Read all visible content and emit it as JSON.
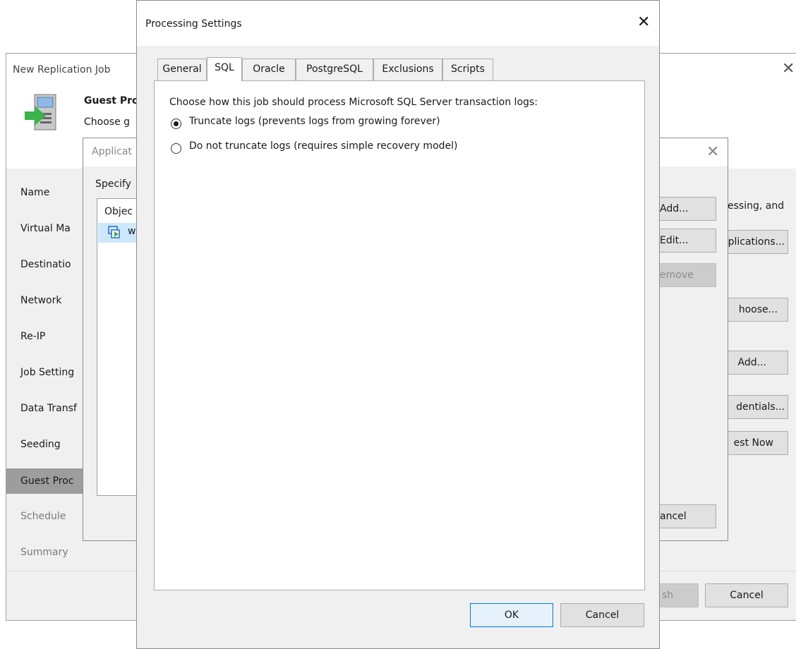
{
  "replication_job": {
    "title": "New Replication Job",
    "header_title": "Guest Pro",
    "header_subtitle": "Choose g",
    "nav": [
      {
        "label": "Name",
        "state": "normal"
      },
      {
        "label": "Virtual Ma",
        "state": "normal"
      },
      {
        "label": "Destinatio",
        "state": "normal"
      },
      {
        "label": "Network",
        "state": "normal"
      },
      {
        "label": "Re-IP",
        "state": "normal"
      },
      {
        "label": "Job Setting",
        "state": "normal"
      },
      {
        "label": "Data Transf",
        "state": "normal"
      },
      {
        "label": "Seeding",
        "state": "normal"
      },
      {
        "label": "Guest Proc",
        "state": "current"
      },
      {
        "label": "Schedule",
        "state": "disabled"
      },
      {
        "label": "Summary",
        "state": "disabled"
      }
    ],
    "right_text": "essing, and",
    "buttons": {
      "applications": "plications...",
      "choose": "hoose...",
      "add": "Add...",
      "credentials": "dentials...",
      "test_now": "est Now",
      "finish": "sh",
      "cancel": "Cancel"
    }
  },
  "application_dialog": {
    "title": "Applicat",
    "specify_label": "Specify",
    "object_header": "Objec",
    "object_row": "w",
    "buttons": {
      "add": "Add...",
      "edit": "Edit...",
      "remove": "emove",
      "cancel": "ancel"
    }
  },
  "processing_settings": {
    "title": "Processing Settings",
    "tabs": [
      "General",
      "SQL",
      "Oracle",
      "PostgreSQL",
      "Exclusions",
      "Scripts"
    ],
    "active_tab": "SQL",
    "sql": {
      "prompt": "Choose how this job should process Microsoft SQL Server transaction logs:",
      "option_truncate": "Truncate logs (prevents logs from growing forever)",
      "option_no_truncate": "Do not truncate logs (requires simple recovery model)",
      "selected": "truncate"
    },
    "buttons": {
      "ok": "OK",
      "cancel": "Cancel"
    }
  },
  "icons": {
    "close": "close-icon",
    "wizard": "replication-wizard-icon",
    "vm": "vm-icon"
  },
  "colors": {
    "accent": "#0078d7",
    "wizard_green": "#3cb34a",
    "selection": "#cce8ff",
    "nav_current": "#9d9d9d"
  }
}
